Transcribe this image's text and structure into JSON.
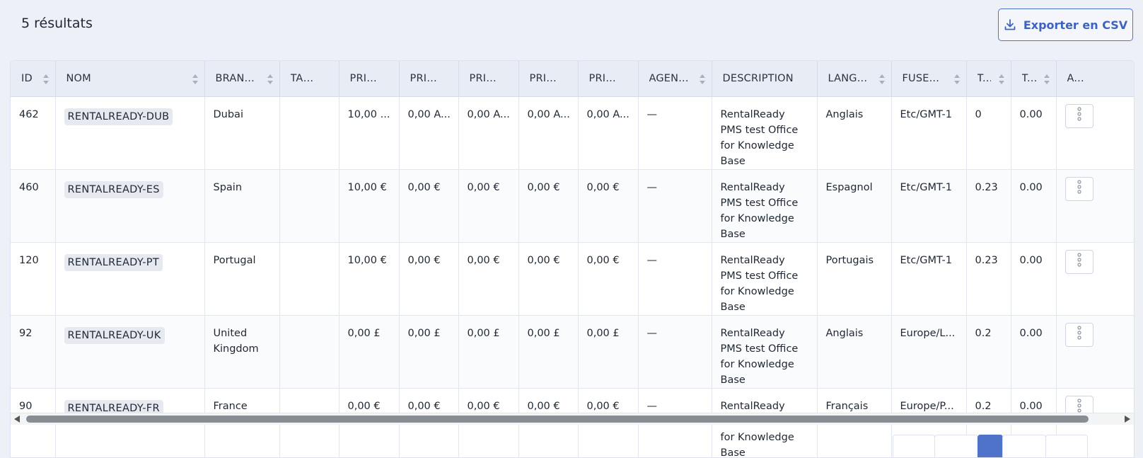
{
  "header": {
    "result_count": "5 résultats",
    "export_label": "Exporter en CSV"
  },
  "columns": [
    {
      "key": "id",
      "label": "ID",
      "sortable": true
    },
    {
      "key": "nom",
      "label": "NOM",
      "sortable": true
    },
    {
      "key": "branch",
      "label": "BRAN...",
      "sortable": true
    },
    {
      "key": "tax",
      "label": "TAXE...",
      "sortable": false
    },
    {
      "key": "prix1",
      "label": "PRIX ...",
      "sortable": false
    },
    {
      "key": "prix2",
      "label": "PRIX ...",
      "sortable": false
    },
    {
      "key": "prix3",
      "label": "PRIX ...",
      "sortable": false
    },
    {
      "key": "prix4",
      "label": "PRIX ...",
      "sortable": false
    },
    {
      "key": "prix5",
      "label": "PRIX ...",
      "sortable": false
    },
    {
      "key": "agent",
      "label": "AGEN...",
      "sortable": true
    },
    {
      "key": "description",
      "label": "DESCRIPTION",
      "sortable": false
    },
    {
      "key": "langue",
      "label": "LANG...",
      "sortable": true
    },
    {
      "key": "fuseau",
      "label": "FUSE...",
      "sortable": true
    },
    {
      "key": "t1",
      "label": "T...",
      "sortable": true
    },
    {
      "key": "t2",
      "label": "T...",
      "sortable": true
    },
    {
      "key": "actions",
      "label": "A...",
      "sortable": false
    }
  ],
  "rows": [
    {
      "id": "462",
      "nom": "RENTALREADY-DUB",
      "branch": "Dubai",
      "tax": "",
      "prix1": "10,00 ...",
      "prix2": "0,00 A...",
      "prix3": "0,00 A...",
      "prix4": "0,00 A...",
      "prix5": "0,00 A...",
      "agent": "—",
      "description": "RentalReady PMS test Office for Knowledge Base",
      "langue": "Anglais",
      "fuseau": "Etc/GMT-1",
      "t1": "0",
      "t2": "0.00"
    },
    {
      "id": "460",
      "nom": "RENTALREADY-ES",
      "branch": "Spain",
      "tax": "",
      "prix1": "10,00 €",
      "prix2": "0,00 €",
      "prix3": "0,00 €",
      "prix4": "0,00 €",
      "prix5": "0,00 €",
      "agent": "—",
      "description": "RentalReady PMS test Office for Knowledge Base",
      "langue": "Espagnol",
      "fuseau": "Etc/GMT-1",
      "t1": "0.23",
      "t2": "0.00"
    },
    {
      "id": "120",
      "nom": "RENTALREADY-PT",
      "branch": "Portugal",
      "tax": "",
      "prix1": "10,00 €",
      "prix2": "0,00 €",
      "prix3": "0,00 €",
      "prix4": "0,00 €",
      "prix5": "0,00 €",
      "agent": "—",
      "description": "RentalReady PMS test Office for Knowledge Base",
      "langue": "Portugais",
      "fuseau": "Etc/GMT-1",
      "t1": "0.23",
      "t2": "0.00"
    },
    {
      "id": "92",
      "nom": "RENTALREADY-UK",
      "branch": "United Kingdom",
      "tax": "",
      "prix1": "0,00 £",
      "prix2": "0,00 £",
      "prix3": "0,00 £",
      "prix4": "0,00 £",
      "prix5": "0,00 £",
      "agent": "—",
      "description": "RentalReady PMS test Office for Knowledge Base",
      "langue": "Anglais",
      "fuseau": "Europe/L...",
      "t1": "0.2",
      "t2": "0.00"
    },
    {
      "id": "90",
      "nom": "RENTALREADY-FR",
      "branch": "France",
      "tax": "",
      "prix1": "0,00 €",
      "prix2": "0,00 €",
      "prix3": "0,00 €",
      "prix4": "0,00 €",
      "prix5": "0,00 €",
      "agent": "—",
      "description": "RentalReady PMS test Office for Knowledge Base",
      "langue": "Français",
      "fuseau": "Europe/P...",
      "t1": "0.2",
      "t2": "0.00"
    }
  ],
  "pagination": {
    "active_index": 2,
    "count": 5
  },
  "colors": {
    "accent": "#4e73c8",
    "header_bg": "#e8ecf5",
    "page_bg": "#edf0f7"
  }
}
